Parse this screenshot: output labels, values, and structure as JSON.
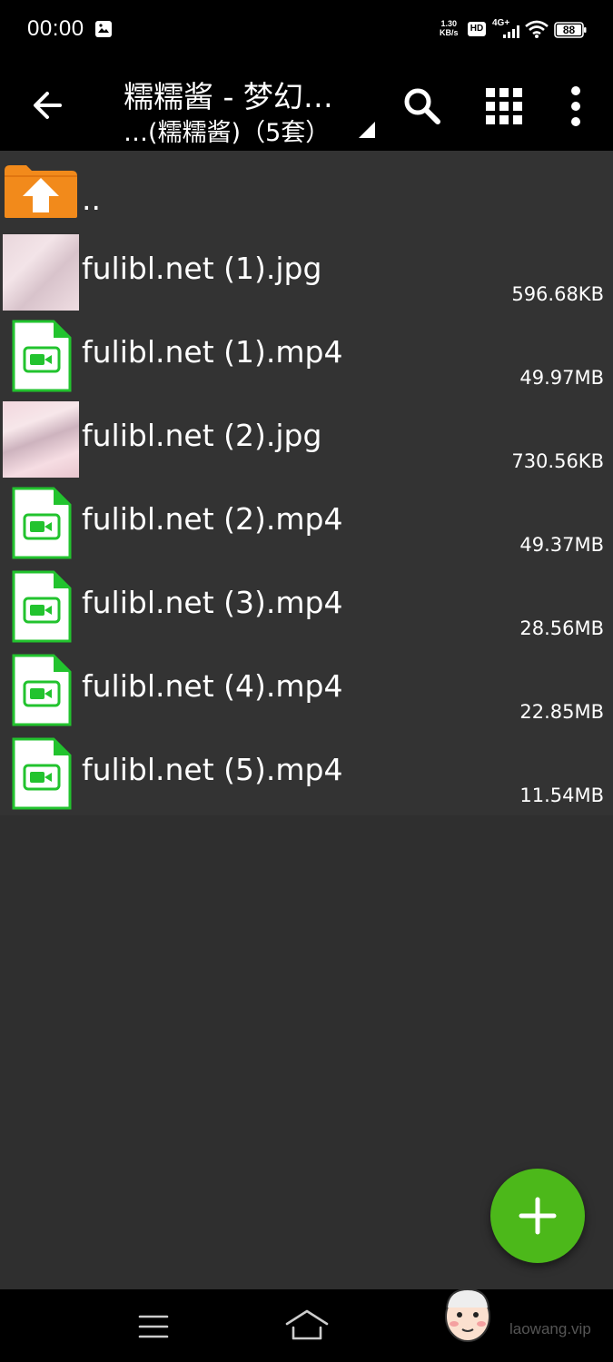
{
  "status_bar": {
    "time": "00:00",
    "net_speed_value": "1.30",
    "net_speed_unit": "KB/s",
    "hd_label": "HD",
    "network_label": "4G+",
    "battery_level": "88"
  },
  "toolbar": {
    "title": "糯糯酱 - 梦幻…",
    "subtitle": "…(糯糯酱)（5套）"
  },
  "files": [
    {
      "name": "..",
      "size": "",
      "type": "parent"
    },
    {
      "name": "fulibl.net (1).jpg",
      "size": "596.68KB",
      "type": "image"
    },
    {
      "name": "fulibl.net (1).mp4",
      "size": "49.97MB",
      "type": "video"
    },
    {
      "name": "fulibl.net (2).jpg",
      "size": "730.56KB",
      "type": "image"
    },
    {
      "name": "fulibl.net (2).mp4",
      "size": "49.37MB",
      "type": "video"
    },
    {
      "name": "fulibl.net (3).mp4",
      "size": "28.56MB",
      "type": "video"
    },
    {
      "name": "fulibl.net (4).mp4",
      "size": "22.85MB",
      "type": "video"
    },
    {
      "name": "fulibl.net (5).mp4",
      "size": "11.54MB",
      "type": "video"
    }
  ],
  "watermark": "laowang.vip",
  "colors": {
    "accent_green": "#4cb81a",
    "folder_orange": "#f28a1b",
    "video_icon_green": "#22c32e",
    "list_background": "#333333"
  }
}
